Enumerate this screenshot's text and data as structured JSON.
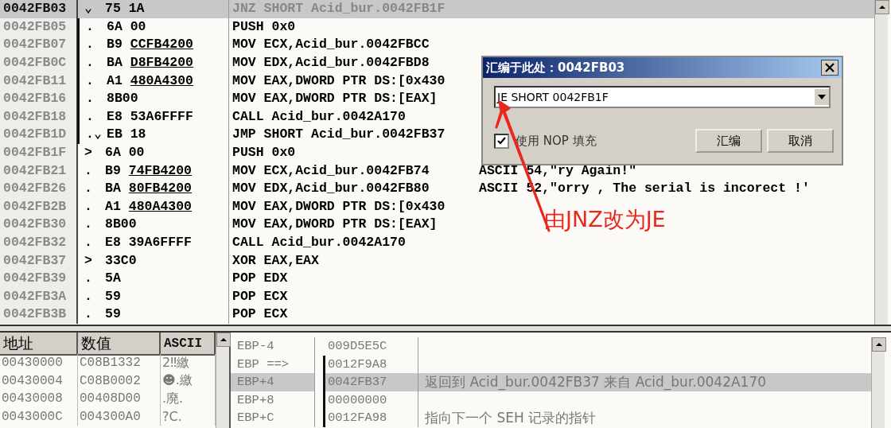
{
  "code_rows": [
    {
      "address": "0042FB03",
      "mark": "⌄",
      "bytes": "75 1A",
      "operand": "",
      "asm": "JNZ SHORT Acid_bur.0042FB1F",
      "comment": "",
      "selected": true,
      "jump_line": false
    },
    {
      "address": "0042FB05",
      "mark": ".",
      "bytes": "6A 00",
      "operand": "",
      "asm": "PUSH 0x0",
      "comment": "",
      "selected": false,
      "jump_line": true
    },
    {
      "address": "0042FB07",
      "mark": ".",
      "bytes": "B9",
      "operand": "CCFB4200",
      "asm": "MOV ECX,Acid_bur.0042FBCC",
      "comment": "",
      "selected": false,
      "jump_line": true
    },
    {
      "address": "0042FB0C",
      "mark": ".",
      "bytes": "BA",
      "operand": "D8FB4200",
      "asm": "MOV EDX,Acid_bur.0042FBD8",
      "comment": "",
      "selected": false,
      "jump_line": true
    },
    {
      "address": "0042FB11",
      "mark": ".",
      "bytes": "A1",
      "operand": "480A4300",
      "asm": "MOV EAX,DWORD PTR DS:[0x430",
      "comment": "",
      "selected": false,
      "jump_line": true
    },
    {
      "address": "0042FB16",
      "mark": ".",
      "bytes": "8B00",
      "operand": "",
      "asm": "MOV EAX,DWORD PTR DS:[EAX]",
      "comment": "",
      "selected": false,
      "jump_line": true
    },
    {
      "address": "0042FB18",
      "mark": ".",
      "bytes": "E8 53A6FFFF",
      "operand": "",
      "asm": "CALL Acid_bur.0042A170",
      "comment": "",
      "selected": false,
      "jump_line": true
    },
    {
      "address": "0042FB1D",
      "mark": ".⌄",
      "bytes": "EB 18",
      "operand": "",
      "asm": "JMP SHORT Acid_bur.0042FB37",
      "comment": "",
      "selected": false,
      "jump_line": true
    },
    {
      "address": "0042FB1F",
      "mark": ">",
      "bytes": "6A 00",
      "operand": "",
      "asm": "PUSH 0x0",
      "comment": "",
      "selected": false,
      "jump_line": false
    },
    {
      "address": "0042FB21",
      "mark": ".",
      "bytes": "B9",
      "operand": "74FB4200",
      "asm": "MOV ECX,Acid_bur.0042FB74",
      "comment": "ASCII 54,\"ry Again!\"",
      "selected": false,
      "jump_line": false
    },
    {
      "address": "0042FB26",
      "mark": ".",
      "bytes": "BA",
      "operand": "80FB4200",
      "asm": "MOV EDX,Acid_bur.0042FB80",
      "comment": "ASCII 52,\"orry , The serial is incorect !'",
      "selected": false,
      "jump_line": false
    },
    {
      "address": "0042FB2B",
      "mark": ".",
      "bytes": "A1",
      "operand": "480A4300",
      "asm": "MOV EAX,DWORD PTR DS:[0x430",
      "comment": "",
      "selected": false,
      "jump_line": false
    },
    {
      "address": "0042FB30",
      "mark": ".",
      "bytes": "8B00",
      "operand": "",
      "asm": "MOV EAX,DWORD PTR DS:[EAX]",
      "comment": "",
      "selected": false,
      "jump_line": false
    },
    {
      "address": "0042FB32",
      "mark": ".",
      "bytes": "E8 39A6FFFF",
      "operand": "",
      "asm": "CALL Acid_bur.0042A170",
      "comment": "",
      "selected": false,
      "jump_line": false
    },
    {
      "address": "0042FB37",
      "mark": ">",
      "bytes": "33C0",
      "operand": "",
      "asm": "XOR EAX,EAX",
      "comment": "",
      "selected": false,
      "jump_line": false
    },
    {
      "address": "0042FB39",
      "mark": ".",
      "bytes": "5A",
      "operand": "",
      "asm": "POP EDX",
      "comment": "",
      "selected": false,
      "jump_line": false
    },
    {
      "address": "0042FB3A",
      "mark": ".",
      "bytes": "59",
      "operand": "",
      "asm": "POP ECX",
      "comment": "",
      "selected": false,
      "jump_line": false
    },
    {
      "address": "0042FB3B",
      "mark": ".",
      "bytes": "59",
      "operand": "",
      "asm": "POP ECX",
      "comment": "",
      "selected": false,
      "jump_line": false
    }
  ],
  "dialog": {
    "title": "汇编于此处：0042FB03",
    "instruction": "JE SHORT 0042FB1F",
    "nop_fill": {
      "label": "使用 NOP 填充",
      "checked": true
    },
    "buttons": [
      "汇编",
      "取消"
    ]
  },
  "annotation": "由JNZ改为JE",
  "dump": {
    "columns": [
      "地址",
      "数值",
      "ASCII"
    ],
    "rows": [
      {
        "address": "00430000",
        "value": "C08B1332",
        "ascii": "2‼繳"
      },
      {
        "address": "00430004",
        "value": "C08B0002",
        "ascii": "☻.繳"
      },
      {
        "address": "00430008",
        "value": "00408D00",
        "ascii": ".廃."
      },
      {
        "address": "0043000C",
        "value": "004300A0",
        "ascii": "?C."
      }
    ]
  },
  "stack_rows": [
    {
      "label": "EBP-4",
      "value": "009D5E5C",
      "comment": "",
      "selected": false,
      "chain": false
    },
    {
      "label": "EBP ==>",
      "value": "0012F9A8",
      "comment": "",
      "selected": false,
      "chain": true
    },
    {
      "label": "EBP+4",
      "value": "0042FB37",
      "comment": "返回到 Acid_bur.0042FB37 来自 Acid_bur.0042A170",
      "selected": true,
      "chain": true
    },
    {
      "label": "EBP+8",
      "value": "00000000",
      "comment": "",
      "selected": false,
      "chain": true
    },
    {
      "label": "EBP+C",
      "value": "0012FA98",
      "comment": "指向下一个 SEH 记录的指针",
      "selected": false,
      "chain": true
    }
  ]
}
